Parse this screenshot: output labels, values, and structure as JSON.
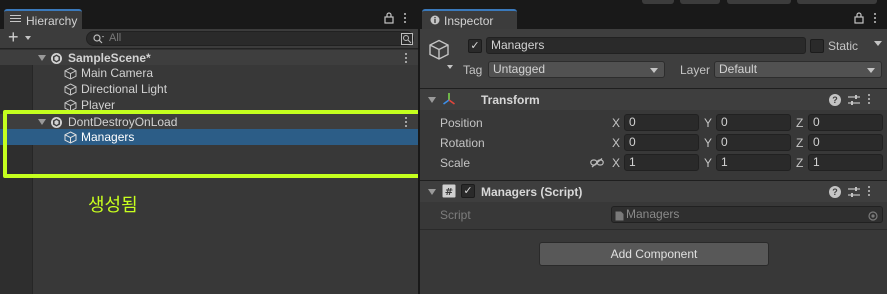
{
  "hierarchy": {
    "tab_label": "Hierarchy",
    "search_placeholder": "All",
    "add_button": "+",
    "rows": [
      {
        "label": "SampleScene*",
        "kind": "scene"
      },
      {
        "label": "Main Camera",
        "kind": "object"
      },
      {
        "label": "Directional Light",
        "kind": "object"
      },
      {
        "label": "Player",
        "kind": "object"
      },
      {
        "label": "DontDestroyOnLoad",
        "kind": "scene"
      },
      {
        "label": "Managers",
        "kind": "object",
        "selected": true
      }
    ]
  },
  "annotation": {
    "text": "생성됨",
    "color": "#c4ff1e"
  },
  "inspector": {
    "tab_label": "Inspector",
    "object_name": "Managers",
    "active": true,
    "static_label": "Static",
    "tag_label": "Tag",
    "tag_value": "Untagged",
    "layer_label": "Layer",
    "layer_value": "Default",
    "transform": {
      "title": "Transform",
      "rows": [
        {
          "label": "Position",
          "x": "0",
          "y": "0",
          "z": "0"
        },
        {
          "label": "Rotation",
          "x": "0",
          "y": "0",
          "z": "0"
        },
        {
          "label": "Scale",
          "x": "1",
          "y": "1",
          "z": "1"
        }
      ],
      "axis_x": "X",
      "axis_y": "Y",
      "axis_z": "Z"
    },
    "script_component": {
      "title": "Managers (Script)",
      "enabled": true,
      "script_label": "Script",
      "script_value": "Managers"
    },
    "add_component_label": "Add Component"
  },
  "colors": {
    "selection": "#2c5d87",
    "accent": "#3a79bb",
    "highlight": "#c4ff1e"
  }
}
